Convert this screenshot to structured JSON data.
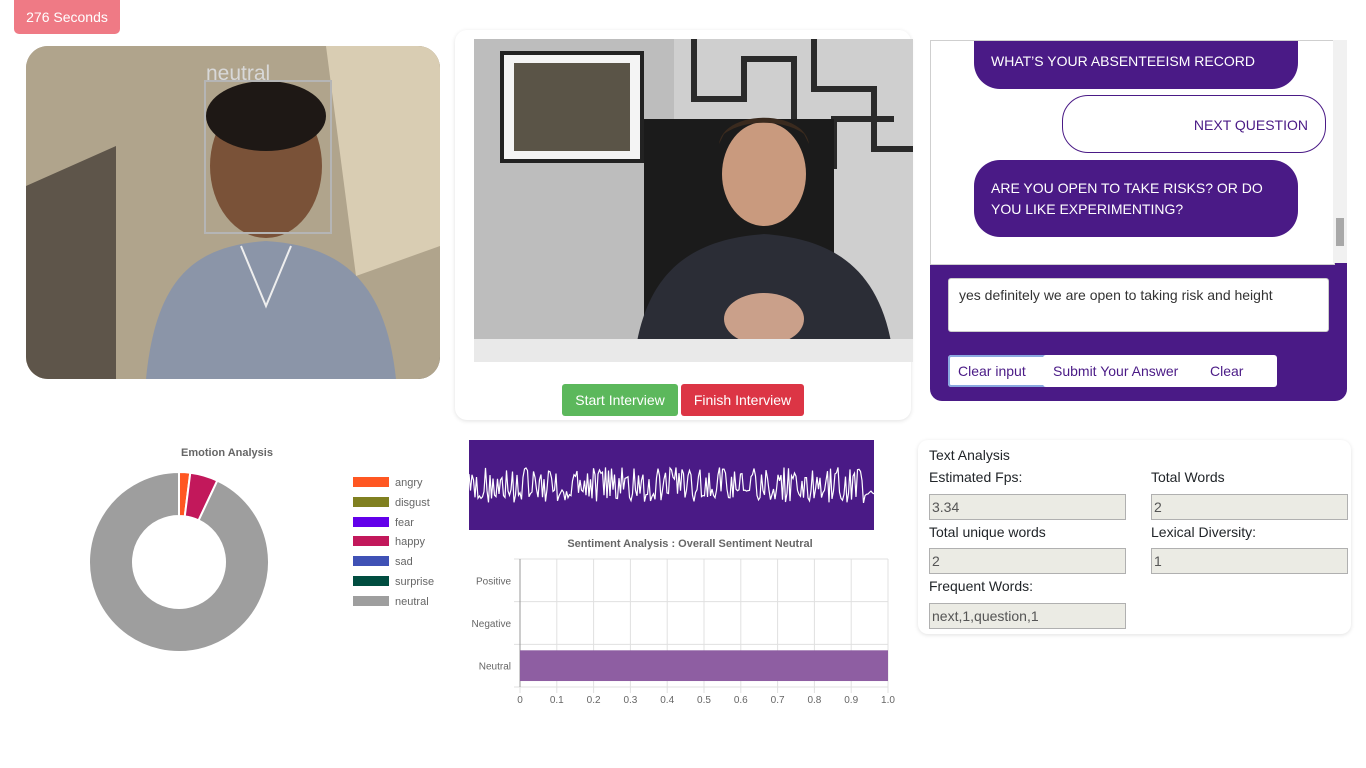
{
  "timer": {
    "text": "276 Seconds"
  },
  "webcam": {
    "detected_emotion": "neutral"
  },
  "controls": {
    "start_label": "Start Interview",
    "finish_label": "Finish Interview"
  },
  "chat": {
    "messages": [
      {
        "from": "bot",
        "text": "WHAT’S YOUR ABSENTEEISM RECORD LIKE?"
      },
      {
        "from": "user",
        "text": "NEXT QUESTION"
      },
      {
        "from": "bot",
        "text": "ARE YOU OPEN TO TAKE RISKS? OR DO YOU LIKE EXPERIMENTING?"
      }
    ],
    "input_value": "yes definitely we are open to taking risk and height",
    "clear_input_label": "Clear input",
    "submit_label": "Submit Your Answer",
    "clear_label": "Clear",
    "accent_color": "#4a1a86"
  },
  "emotion_chart": {
    "title": "Emotion Analysis",
    "type": "pie",
    "labels": [
      "angry",
      "disgust",
      "fear",
      "happy",
      "sad",
      "surprise",
      "neutral"
    ],
    "values": [
      2,
      0,
      0,
      5,
      0,
      0,
      93
    ],
    "colors": [
      "#ff5722",
      "#808020",
      "#6200ea",
      "#c2185b",
      "#3f51b5",
      "#004d40",
      "#9e9e9e"
    ],
    "legend_position": "right"
  },
  "chart_data": {
    "type": "bar",
    "orientation": "horizontal",
    "title": "Sentiment Analysis : Overall Sentiment Neutral",
    "categories": [
      "Positive",
      "Negative",
      "Neutral"
    ],
    "values": [
      0,
      0,
      1
    ],
    "xlim": [
      0,
      1.0
    ],
    "x_ticks": [
      "0",
      "0.1",
      "0.2",
      "0.3",
      "0.4",
      "0.5",
      "0.6",
      "0.7",
      "0.8",
      "0.9",
      "1.0"
    ],
    "bar_color": "#8e5ea2",
    "grid": true
  },
  "text_analysis": {
    "title": "Text Analysis",
    "fps_label": "Estimated Fps:",
    "fps_value": "3.34",
    "total_words_label": "Total Words",
    "total_words_value": "2",
    "unique_words_label": "Total unique words",
    "unique_words_value": "2",
    "lexical_label": "Lexical Diversity:",
    "lexical_value": "1",
    "frequent_label": "Frequent Words:",
    "frequent_value": "next,1,question,1"
  }
}
